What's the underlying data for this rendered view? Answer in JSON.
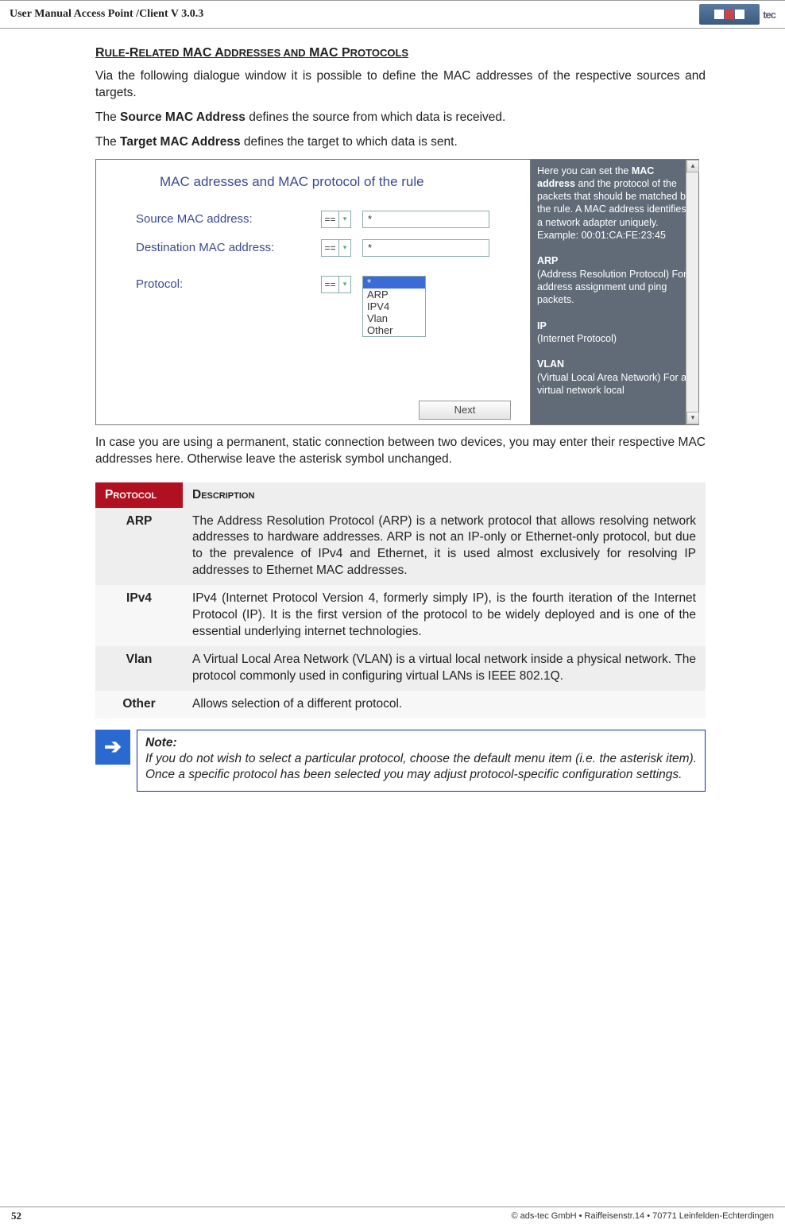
{
  "header": {
    "title": "User Manual Access Point /Client V 3.0.3",
    "logo_text": "tec"
  },
  "section_heading": {
    "p1": "R",
    "p2": "ULE",
    "p3": "-R",
    "p4": "ELATED",
    "p5": " MAC A",
    "p6": "DDRESSES",
    "p7": "  AND",
    "p8": " MAC P",
    "p9": "ROTOCOLS"
  },
  "intro": {
    "p1": "Via the following dialogue window it is possible to define the MAC addresses of the respective sources and targets.",
    "p2a": "The ",
    "p2b": "Source MAC Address",
    "p2c": " defines the source from which data is received.",
    "p3a": "The ",
    "p3b": "Target MAC Address",
    "p3c": " defines the target to which data is sent."
  },
  "screenshot": {
    "title": "MAC adresses and MAC protocol of the rule",
    "rows": {
      "src": {
        "label": "Source MAC address:",
        "op": "==",
        "value": "*"
      },
      "dst": {
        "label": "Destination MAC address:",
        "op": "==",
        "value": "*"
      },
      "proto": {
        "label": "Protocol:",
        "op": "=="
      }
    },
    "proto_options": [
      "*",
      "ARP",
      "IPV4",
      "Vlan",
      "Other"
    ],
    "next": "Next",
    "help": {
      "l1a": "Here you can set the ",
      "l1b": "MAC address",
      "l1c": " and the protocol of the packets that should be matched by the rule. A MAC address identifies a network adapter uniquely.",
      "ex": "Example: 00:01:CA:FE:23:45",
      "arp_t": "ARP",
      "arp_d": "(Address Resolution Protocol) For address assignment und ping packets.",
      "ip_t": "IP",
      "ip_d": "(Internet Protocol)",
      "vlan_t": "VLAN",
      "vlan_d": "(Virtual Local Area Network) For a virtual network local"
    }
  },
  "after_ss": "In case you are using a permanent, static connection between two devices, you may enter their respective MAC addresses here. Otherwise leave the asterisk symbol unchanged.",
  "table": {
    "h1": "Protocol",
    "h2": "Description",
    "rows": [
      {
        "name": "ARP",
        "desc": "The Address Resolution Protocol (ARP) is a network protocol that allows resolving network addresses to hardware addresses. ARP is not an IP-only or Ethernet-only protocol, but due to the prevalence of IPv4 and Ethernet, it is used almost exclusively for resolving IP addresses to Ethernet MAC addresses."
      },
      {
        "name": "IPv4",
        "desc": "IPv4 (Internet Protocol Version 4, formerly simply IP), is the fourth iteration of the Internet Protocol (IP). It is the first version of the protocol to be widely deployed and is one of the essential underlying internet technologies."
      },
      {
        "name": "Vlan",
        "desc": "A Virtual Local Area Network (VLAN) is a virtual local network inside a physical network. The protocol commonly used in configuring virtual LANs is IEEE 802.1Q."
      },
      {
        "name": "Other",
        "desc": "Allows selection of a different protocol."
      }
    ]
  },
  "note": {
    "title": "Note:",
    "body": "If you do not wish to select a particular protocol, choose the default menu item (i.e. the asterisk item). Once a specific protocol has been selected you may adjust protocol-specific configuration settings."
  },
  "footer": {
    "page": "52",
    "copyright": "© ads-tec GmbH • Raiffeisenstr.14 • 70771 Leinfelden-Echterdingen"
  }
}
